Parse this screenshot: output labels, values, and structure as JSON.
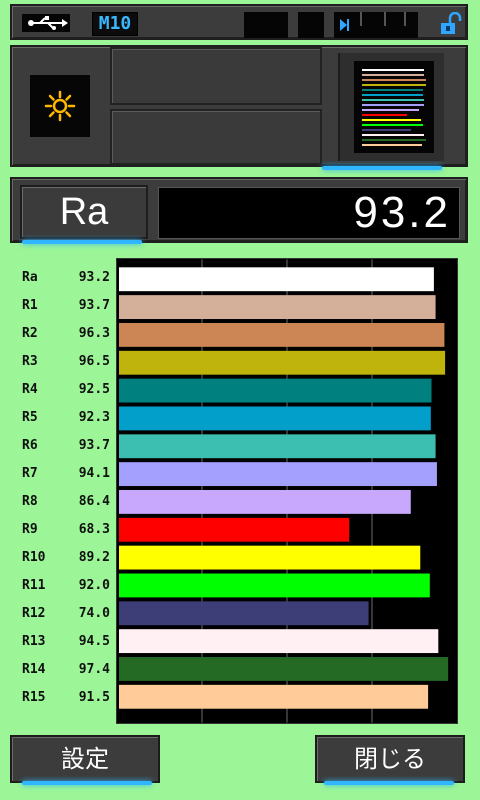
{
  "status_bar": {
    "usb_icon": "usb-icon",
    "mode": "M10",
    "lock_icon": "unlocked-padlock-icon",
    "play_icon": "play-step-icon",
    "accent": "#39b7ff"
  },
  "header": {
    "light_icon": "sun-icon",
    "icon_color": "#ffb800"
  },
  "ra_display": {
    "label": "Ra",
    "value": "93.2"
  },
  "chart_data": {
    "type": "bar",
    "orientation": "horizontal",
    "xlim": [
      0,
      100
    ],
    "grid": true,
    "categories": [
      "Ra",
      "R1",
      "R2",
      "R3",
      "R4",
      "R5",
      "R6",
      "R7",
      "R8",
      "R9",
      "R10",
      "R11",
      "R12",
      "R13",
      "R14",
      "R15"
    ],
    "values": [
      93.2,
      93.7,
      96.3,
      96.5,
      92.5,
      92.3,
      93.7,
      94.1,
      86.4,
      68.3,
      89.2,
      92.0,
      74.0,
      94.5,
      97.4,
      91.5
    ],
    "value_labels": [
      "93.2",
      "93.7",
      "96.3",
      "96.5",
      "92.5",
      "92.3",
      "93.7",
      "94.1",
      "86.4",
      "68.3",
      "89.2",
      "92.0",
      "74.0",
      "94.5",
      "97.4",
      "91.5"
    ],
    "colors": [
      "#ffffff",
      "#d4b09a",
      "#cc8655",
      "#bfb40c",
      "#00807e",
      "#039fcb",
      "#3cbeb0",
      "#a3a1fd",
      "#c8a8fd",
      "#ff0000",
      "#ffff00",
      "#00ff00",
      "#3d3e78",
      "#fff0f3",
      "#246a24",
      "#ffcc99"
    ]
  },
  "buttons": {
    "settings": "設定",
    "close": "閉じる"
  }
}
